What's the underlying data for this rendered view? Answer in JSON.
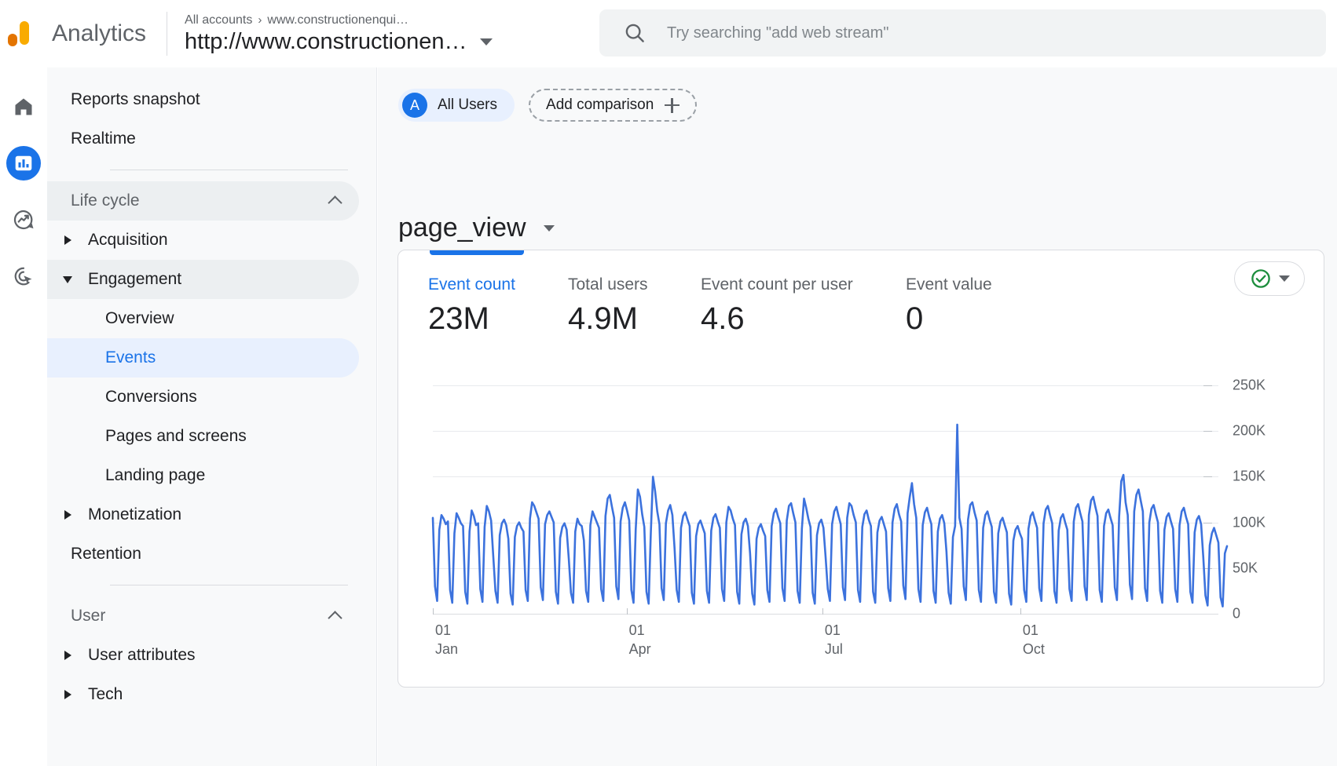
{
  "app": {
    "brand": "Analytics",
    "logo_icon": "analytics-logo-icon"
  },
  "account": {
    "breadcrumb_root": "All accounts",
    "breadcrumb_separator": "›",
    "breadcrumb_property": "www.constructionenqui…",
    "selected_property": "http://www.constructionen…",
    "dropdown_icon": "chevron-down-icon"
  },
  "search": {
    "placeholder": "Try searching \"add web stream\"",
    "icon": "search-icon"
  },
  "rail": {
    "items": [
      {
        "name": "home",
        "icon": "home-icon",
        "active": false
      },
      {
        "name": "reports",
        "icon": "bar-chart-icon",
        "active": true
      },
      {
        "name": "explore",
        "icon": "explore-trend-icon",
        "active": false
      },
      {
        "name": "advertising",
        "icon": "ads-click-target-icon",
        "active": false
      }
    ]
  },
  "sidebar": {
    "items": [
      {
        "label": "Reports snapshot",
        "type": "toplevel",
        "state": "normal"
      },
      {
        "label": "Realtime",
        "type": "toplevel",
        "state": "normal"
      },
      {
        "label": "Life cycle",
        "type": "section",
        "state": "hovered",
        "collapse_icon": "chevron-up-icon"
      },
      {
        "label": "Acquisition",
        "type": "expandable",
        "state": "normal",
        "arrow": "triangle-right-icon"
      },
      {
        "label": "Engagement",
        "type": "expandable",
        "state": "hovered",
        "arrow": "triangle-down-icon"
      },
      {
        "label": "Overview",
        "type": "child",
        "state": "normal"
      },
      {
        "label": "Events",
        "type": "child",
        "state": "selected"
      },
      {
        "label": "Conversions",
        "type": "child",
        "state": "normal"
      },
      {
        "label": "Pages and screens",
        "type": "child",
        "state": "normal"
      },
      {
        "label": "Landing page",
        "type": "child",
        "state": "normal"
      },
      {
        "label": "Monetization",
        "type": "expandable",
        "state": "normal",
        "arrow": "triangle-right-icon"
      },
      {
        "label": "Retention",
        "type": "child-flat",
        "state": "normal"
      },
      {
        "label": "User",
        "type": "section",
        "state": "plain",
        "collapse_icon": "chevron-up-icon"
      },
      {
        "label": "User attributes",
        "type": "expandable",
        "state": "normal",
        "arrow": "triangle-right-icon"
      },
      {
        "label": "Tech",
        "type": "expandable",
        "state": "normal",
        "arrow": "triangle-right-icon"
      }
    ]
  },
  "comparison": {
    "all_users_avatar": "A",
    "all_users_label": "All Users",
    "add_comparison_label": "Add comparison",
    "add_icon": "plus-icon"
  },
  "report": {
    "event_name": "page_view",
    "event_dropdown_icon": "chevron-down-icon",
    "status_icon": "green-check-circle-icon",
    "status_dropdown_icon": "chevron-down-icon",
    "status_color": "#1e8e3e"
  },
  "metrics": [
    {
      "label": "Event count",
      "value": "23M",
      "active": true
    },
    {
      "label": "Total users",
      "value": "4.9M",
      "active": false
    },
    {
      "label": "Event count per user",
      "value": "4.6",
      "active": false
    },
    {
      "label": "Event value",
      "value": "0",
      "active": false
    }
  ],
  "chart_data": {
    "type": "line",
    "title": "",
    "xlabel": "",
    "ylabel": "",
    "series_color": "#3c72dd",
    "grid": true,
    "legend": false,
    "ylim": [
      0,
      262000
    ],
    "yticks": [
      0,
      50000,
      100000,
      150000,
      200000,
      250000
    ],
    "ytick_labels": [
      "0",
      "50K",
      "100K",
      "150K",
      "200K",
      "250K"
    ],
    "xtick_labels": [
      {
        "day": "01",
        "month": "Jan"
      },
      {
        "day": "01",
        "month": "Apr"
      },
      {
        "day": "01",
        "month": "Jul"
      },
      {
        "day": "01",
        "month": "Oct"
      }
    ],
    "xtick_positions": [
      0,
      0.2466,
      0.4959,
      0.7479
    ],
    "x_count": 365,
    "notes": "Daily event count over one year; strong weekly seasonality (weekday peaks ~90-130K, weekend troughs ~10-25K); one outlier spike ~207K in early August.",
    "values": [
      105000,
      30000,
      14000,
      92000,
      108000,
      104000,
      98000,
      101000,
      26000,
      12000,
      88000,
      110000,
      105000,
      99000,
      96000,
      24000,
      11000,
      90000,
      113000,
      107000,
      97000,
      99000,
      27000,
      13000,
      95000,
      118000,
      112000,
      102000,
      63000,
      25000,
      12000,
      86000,
      99000,
      103000,
      97000,
      82000,
      22000,
      10000,
      84000,
      96000,
      100000,
      94000,
      90000,
      26000,
      14000,
      104000,
      122000,
      118000,
      111000,
      104000,
      29000,
      15000,
      98000,
      108000,
      112000,
      106000,
      100000,
      24000,
      11000,
      83000,
      95000,
      99000,
      92000,
      60000,
      23000,
      12000,
      90000,
      104000,
      98000,
      96000,
      80000,
      25000,
      13000,
      97000,
      112000,
      106000,
      100000,
      94000,
      27000,
      14000,
      107000,
      126000,
      130000,
      117000,
      105000,
      30000,
      16000,
      101000,
      116000,
      122000,
      113000,
      102000,
      26000,
      12000,
      92000,
      136000,
      128000,
      109000,
      95000,
      24000,
      11000,
      88000,
      150000,
      134000,
      112000,
      98000,
      28000,
      15000,
      99000,
      113000,
      119000,
      108000,
      72000,
      26000,
      13000,
      94000,
      107000,
      111000,
      103000,
      96000,
      23000,
      11000,
      85000,
      98000,
      102000,
      95000,
      88000,
      25000,
      12000,
      91000,
      105000,
      109000,
      101000,
      94000,
      27000,
      14000,
      100000,
      117000,
      113000,
      104000,
      97000,
      24000,
      11000,
      87000,
      100000,
      104000,
      96000,
      66000,
      22000,
      10000,
      82000,
      94000,
      98000,
      91000,
      85000,
      26000,
      13000,
      96000,
      110000,
      115000,
      106000,
      99000,
      28000,
      14000,
      102000,
      118000,
      121000,
      110000,
      100000,
      25000,
      12000,
      93000,
      126000,
      116000,
      104000,
      95000,
      23000,
      11000,
      86000,
      99000,
      103000,
      94000,
      62000,
      27000,
      14000,
      98000,
      112000,
      117000,
      107000,
      98000,
      29000,
      15000,
      105000,
      121000,
      118000,
      108000,
      100000,
      26000,
      13000,
      95000,
      109000,
      113000,
      103000,
      96000,
      24000,
      12000,
      89000,
      102000,
      106000,
      98000,
      90000,
      28000,
      14000,
      100000,
      115000,
      120000,
      109000,
      101000,
      31000,
      16000,
      110000,
      128000,
      143000,
      120000,
      105000,
      27000,
      13000,
      97000,
      111000,
      116000,
      106000,
      98000,
      25000,
      12000,
      90000,
      104000,
      108000,
      99000,
      68000,
      23000,
      11000,
      84000,
      96000,
      207000,
      105000,
      93000,
      30000,
      15000,
      103000,
      119000,
      122000,
      111000,
      102000,
      26000,
      13000,
      94000,
      108000,
      112000,
      103000,
      95000,
      24000,
      12000,
      88000,
      101000,
      105000,
      97000,
      89000,
      22000,
      10000,
      80000,
      92000,
      96000,
      88000,
      82000,
      26000,
      13000,
      93000,
      107000,
      111000,
      102000,
      94000,
      28000,
      14000,
      99000,
      114000,
      118000,
      108000,
      99000,
      25000,
      12000,
      91000,
      105000,
      109000,
      100000,
      92000,
      27000,
      14000,
      101000,
      116000,
      120000,
      110000,
      101000,
      30000,
      15000,
      108000,
      124000,
      128000,
      117000,
      107000,
      26000,
      13000,
      96000,
      110000,
      114000,
      105000,
      97000,
      29000,
      15000,
      106000,
      145000,
      152000,
      122000,
      108000,
      32000,
      16000,
      112000,
      130000,
      136000,
      124000,
      112000,
      28000,
      14000,
      100000,
      115000,
      119000,
      109000,
      100000,
      25000,
      12000,
      92000,
      106000,
      110000,
      101000,
      93000,
      27000,
      13000,
      97000,
      112000,
      116000,
      106000,
      98000,
      24000,
      12000,
      89000,
      103000,
      107000,
      98000,
      62000,
      20000,
      9000,
      75000,
      88000,
      94000,
      86000,
      78000,
      18000,
      8000,
      66000,
      74000
    ]
  }
}
